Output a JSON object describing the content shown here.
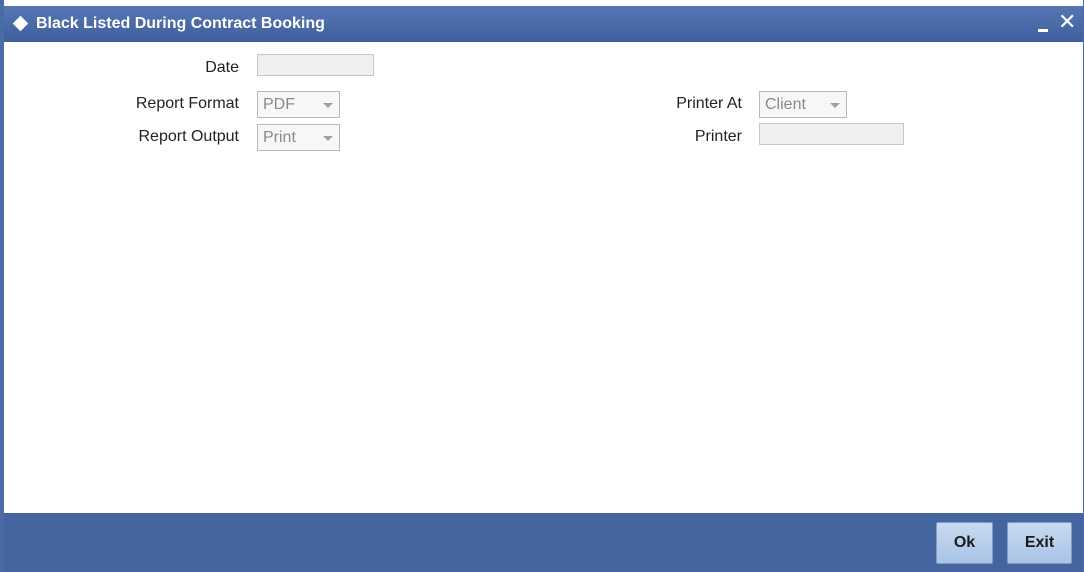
{
  "window": {
    "title": "Black Listed During Contract Booking",
    "minimize_icon": "minimize-icon",
    "close_icon": "close-icon",
    "close_glyph": "✕"
  },
  "form": {
    "date": {
      "label": "Date",
      "value": ""
    },
    "report_format": {
      "label": "Report Format",
      "value": "PDF"
    },
    "report_output": {
      "label": "Report Output",
      "value": "Print"
    },
    "printer_at": {
      "label": "Printer At",
      "value": "Client"
    },
    "printer": {
      "label": "Printer",
      "value": ""
    }
  },
  "footer": {
    "ok_label": "Ok",
    "exit_label": "Exit"
  },
  "colors": {
    "title_bar": "#4a6ba5",
    "footer_bar": "#4465a0",
    "button": "#b8cdea"
  }
}
